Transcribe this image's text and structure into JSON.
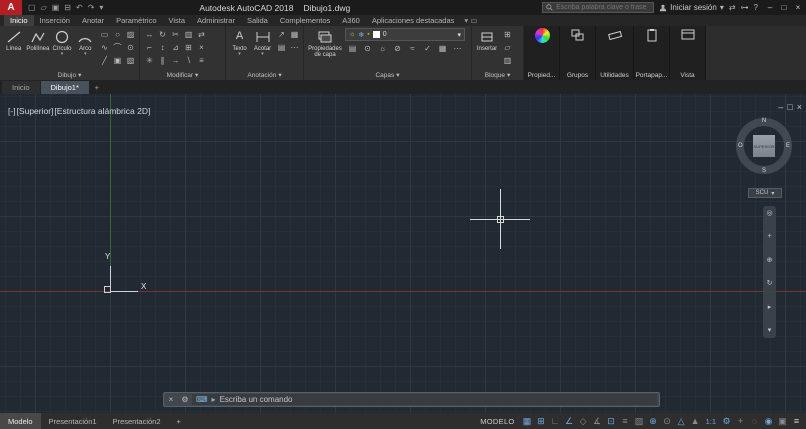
{
  "colors": {
    "logo_red": "#b41f24",
    "status_icon_on": "#6fa8dc",
    "axis_x_red": "#7d3232",
    "axis_y_green": "#2f6b33",
    "viewport_bg": "#212a33"
  },
  "title_bar": {
    "logo_letter": "A",
    "app_title": "Autodesk AutoCAD 2018",
    "doc_title": "Dibujo1.dwg",
    "search_placeholder": "Escriba palabra clave o frase",
    "sign_in_label": "Iniciar sesión"
  },
  "ribbon": {
    "tabs": [
      "Inicio",
      "Inserción",
      "Anotar",
      "Paramétrico",
      "Vista",
      "Administrar",
      "Salida",
      "Complementos",
      "A360",
      "Aplicaciones destacadas"
    ],
    "dibujo": {
      "label": "Dibujo",
      "linea": "Línea",
      "polilinea": "Polilínea",
      "circulo": "Círculo",
      "arco": "Arco"
    },
    "modificar": {
      "label": "Modificar"
    },
    "anotacion": {
      "label": "Anotación",
      "texto": "Texto",
      "acotar": "Acotar"
    },
    "capas": {
      "label": "Capas",
      "propiedades": "Propiedades de capa",
      "layer_actual": "0"
    },
    "bloque": {
      "label": "Bloque",
      "insertar": "Insertar"
    },
    "propiedades": {
      "label": "Propied..."
    },
    "grupos": {
      "label": "Grupos"
    },
    "utilidades": {
      "label": "Utilidades"
    },
    "portapapeles": {
      "label": "Portapap..."
    },
    "vista": {
      "label": "Vista"
    }
  },
  "file_tabs": {
    "inicio": "Inicio",
    "dibujo1": "Dibujo1*",
    "new_tab": "+"
  },
  "viewport": {
    "controls_minus": "[-]",
    "controls_view": "[Superior]",
    "controls_visual": "[Estructura alámbrica 2D]",
    "viewcube": {
      "n": "N",
      "s": "S",
      "o": "O",
      "e": "E",
      "face": "SUPERIOR",
      "coord": "SCU"
    },
    "axis_x_label": "X",
    "axis_y_label": "Y"
  },
  "command_line": {
    "prompt": "Escriba un comando"
  },
  "status_bar": {
    "tabs": {
      "modelo": "Modelo",
      "pres1": "Presentación1",
      "pres2": "Presentación2",
      "add": "+"
    },
    "model_label": "MODELO",
    "scale": "1:1",
    "icons": [
      {
        "name": "grid-icon",
        "glyph": "▦"
      },
      {
        "name": "snap-icon",
        "glyph": "⊞"
      },
      {
        "name": "ortho-icon",
        "glyph": "∟"
      },
      {
        "name": "polar-tracking-icon",
        "glyph": "∠"
      },
      {
        "name": "isodraft-icon",
        "glyph": "◇"
      },
      {
        "name": "object-snap-tracking-icon",
        "glyph": "∡"
      },
      {
        "name": "object-snap-icon",
        "glyph": "⊡"
      },
      {
        "name": "lineweight-icon",
        "glyph": "≡"
      },
      {
        "name": "transparency-icon",
        "glyph": "▨"
      },
      {
        "name": "dynamic-input-icon",
        "glyph": "⊕"
      },
      {
        "name": "selection-cycling-icon",
        "glyph": "⊙"
      },
      {
        "name": "annotation-visibility-icon",
        "glyph": "△"
      },
      {
        "name": "autoscale-icon",
        "glyph": "▲"
      },
      {
        "name": "workspace-icon",
        "glyph": "⚙"
      },
      {
        "name": "annotation-monitor-icon",
        "glyph": "+"
      },
      {
        "name": "isolate-objects-icon",
        "glyph": "◌"
      },
      {
        "name": "graphics-performance-icon",
        "glyph": "◉"
      },
      {
        "name": "clean-screen-icon",
        "glyph": "▣"
      },
      {
        "name": "customization-icon",
        "glyph": "≡"
      }
    ]
  }
}
